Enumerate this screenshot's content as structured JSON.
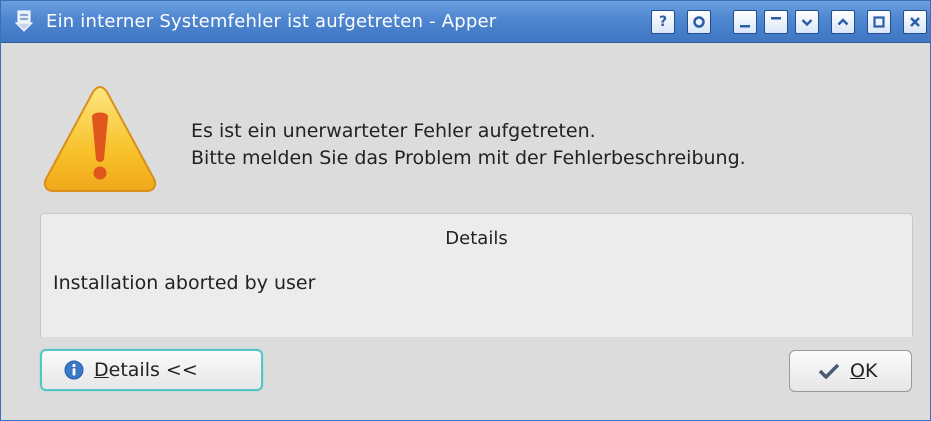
{
  "window": {
    "title": "Ein interner Systemfehler ist aufgetreten - Apper",
    "titlebar_buttons": [
      {
        "name": "help-button",
        "glyph": "?"
      },
      {
        "name": "shade-button",
        "glyph": "circle"
      },
      {
        "name": "minimize-button",
        "glyph": "underscore"
      },
      {
        "name": "keep-above-button",
        "glyph": "overline"
      },
      {
        "name": "keep-below-button",
        "glyph": "chevron-down"
      },
      {
        "name": "maximize-up-button",
        "glyph": "chevron-up"
      },
      {
        "name": "maximize-button",
        "glyph": "square"
      },
      {
        "name": "close-button",
        "glyph": "x"
      }
    ]
  },
  "message": {
    "line1": "Es ist ein unerwarteter Fehler aufgetreten.",
    "line2": "Bitte melden Sie das Problem mit der Fehlerbeschreibung."
  },
  "details": {
    "title": "Details",
    "content": "Installation aborted by user"
  },
  "buttons": {
    "details_mnemonic": "D",
    "details_rest": "etails <<",
    "ok_mnemonic": "O",
    "ok_rest": "K"
  },
  "icons": {
    "warning": "warning-icon",
    "info": "info-icon",
    "checkmark": "checkmark-icon"
  },
  "colors": {
    "titlebar": "#4f86d0",
    "warning_fill": "#f7c631",
    "warning_mark": "#e0561c",
    "info_blue": "#3a78c8"
  }
}
